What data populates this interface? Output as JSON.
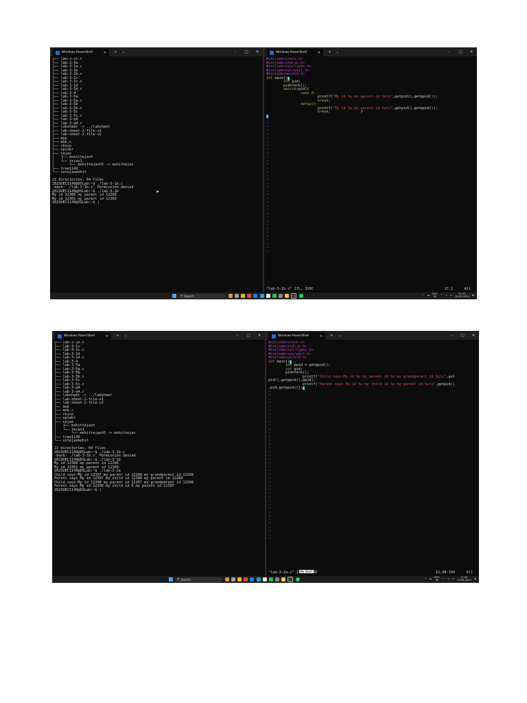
{
  "shots": [
    {
      "left": {
        "title": "Windows PowerShell",
        "lines": [
          "├── lab-3-2c.c",
          "├── lab-3-3a",
          "├── lab-3-1a.c",
          "├── lab-3-1b",
          "├── lab-3-1b.c",
          "├── lab-3-1c",
          "├── lab-3-1c.c",
          "├── lab-3-1d",
          "├── lab-3-1d.c",
          "├── lab-3-4",
          "├── lab-3-5a",
          "├── lab-3-5a.c",
          "├── lab-3-5b",
          "├── lab-3-5b.c",
          "├── lab-3-5c",
          "├── lab-3-5c.c",
          "├── lab-3-q4",
          "├── lab-3-q4.c",
          "├── labsheet -> ../labsheet",
          "├── lab-sheet-2-file-v1",
          "├── lab-sheet-2-file-v2",
          "├── mok",
          "├── mok.c",
          "├── rhino",
          "├── spider",
          "├── tejas",
          "│   ├── mohittejash",
          "│   └── tejas1",
          "│       └── mohittejash5 -> mohittejas",
          "├── tree1149",
          "└── ustejasmohit",
          "",
          "21 directories, 64 files",
          "2023UEC1149@OSLab:~$ ./lab-3-1b.c",
          "-bash: ./lab-3-1b.c: Permission denied",
          "2023UEC1149@OSLab:~$ ./lab-3-1b",
          "My id 12360 my parent id 12268",
          "My id 12361 my parent id 12360",
          "2023UEC1149@OSLab:~$ |"
        ]
      },
      "right": {
        "title": "Windows PowerShell",
        "code": [
          [
            [
              "cm",
              "#include<stdio.h>"
            ]
          ],
          [
            [
              "cm",
              "#include<stdlib.h>"
            ]
          ],
          [
            [
              "cm",
              "#include<sys/types.h>"
            ]
          ],
          [
            [
              "cm",
              "#include<sys/wait.h>"
            ]
          ],
          [
            [
              "cm",
              "#include<unistd.h>"
            ]
          ],
          [
            [
              "ky",
              "int"
            ],
            [
              "tx",
              " main()"
            ],
            [
              "cur",
              ""
            ]
          ],
          [
            [
              "tx",
              "        "
            ],
            [
              "ky",
              "int"
            ],
            [
              "tx",
              " pid;"
            ]
          ],
          [
            [
              "tx",
              "        pid=fork();"
            ]
          ],
          [
            [
              "tx",
              "        "
            ],
            [
              "ky",
              "switch"
            ],
            [
              "tx",
              "(pid){"
            ]
          ],
          [
            [
              "tx",
              "                "
            ],
            [
              "ky",
              "case 0:"
            ]
          ],
          [
            [
              "tx",
              "                        printf("
            ],
            [
              "st",
              "\"My id %u my parent id %u\\n\""
            ],
            [
              "tx",
              ",getpid(),getppid());"
            ]
          ],
          [
            [
              "tx",
              "                        "
            ],
            [
              "ky",
              "break;"
            ]
          ],
          [
            [
              "tx",
              "                "
            ],
            [
              "ky",
              "default:"
            ]
          ],
          [
            [
              "tx",
              "                        printf("
            ],
            [
              "st",
              "\"My id %u my parent id %u\\n\""
            ],
            [
              "tx",
              ",getpid(),getppid());"
            ]
          ],
          [
            [
              "tx",
              "                        "
            ],
            [
              "ky",
              "break;"
            ],
            [
              "tx",
              "              }"
            ]
          ],
          [
            [
              "cur",
              ""
            ]
          ]
        ],
        "status_file": "\"lab-3-1b.c\" 17L, 310C",
        "status_pos": "17,1",
        "status_all": "All"
      },
      "taskbar": {
        "search": "Search",
        "lang": "ENG\nIN",
        "time": "21:43\n19-09-2024"
      }
    },
    {
      "left": {
        "title": "Windows PowerShell",
        "lines": [
          "├── lab-3-1b.c",
          "├── lab-3-1c",
          "├── lab-3-1c.c",
          "├── lab-3-1d",
          "├── lab-3-1d.c",
          "├── lab-3-4",
          "├── lab-3-5a",
          "├── lab-3-5a.c",
          "├── lab-3-5b",
          "├── lab-3-5b.c",
          "├── lab-3-5c",
          "├── lab-3-5c.c",
          "├── lab-3-q4",
          "├── lab-3-q4.c",
          "├── labsheet -> ../labsheet",
          "├── lab-sheet-2-file-v1",
          "├── lab-sheet-2-file-v2",
          "├── mok",
          "├── mok.c",
          "├── rhino",
          "├── spider",
          "├── tejas",
          "│   ├── mohittejash",
          "│   └── tejas1",
          "│       └── mohittejash5 -> mohittejas",
          "├── tree1149",
          "└── ustejasmohit",
          "",
          "21 directories, 64 files",
          "2023UEC1149@OSLab:~$ ./lab-3-1b.c",
          "-bash: ./lab-3-1b.c: Permission denied",
          "2023UEC1149@OSLab:~$ ./lab-3-1b",
          "My id 12360 my parent id 12268",
          "My id 12361 my parent id 12360",
          "2023UEC1149@OSLab:~$ ./lab-3-2a",
          "Child says-My id 12397 my parent id 12268 my grandparent id 12268",
          "Parent says My id 12397 my child id 12398 my parent id 12268",
          "Child says-My id 12398 my parent id 12397 my grandparent id 12268",
          "Parent says My id 12398 my child id 0 my parent id 12397",
          "2023UEC1149@OSLab:~$ |"
        ]
      },
      "right": {
        "title": "Windows PowerShell",
        "code": [
          [
            [
              "cm",
              "#include<stdio.h>"
            ]
          ],
          [
            [
              "cm",
              "#include<stdlib.h>"
            ]
          ],
          [
            [
              "cm",
              "#include<sys/types.h>"
            ]
          ],
          [
            [
              "cm",
              "#include<sys/wait.h>"
            ]
          ],
          [
            [
              "cm",
              "#include<unistd.h>"
            ]
          ],
          [
            [
              "ky",
              "int"
            ],
            [
              "tx",
              " main()"
            ],
            [
              "cur",
              ""
            ]
          ],
          [
            [
              "tx",
              "        "
            ],
            [
              "ky",
              "int"
            ],
            [
              "tx",
              " ppid = getppid();"
            ]
          ],
          [
            [
              "tx",
              "        "
            ],
            [
              "ky",
              "int"
            ],
            [
              "tx",
              " pid;"
            ]
          ],
          [
            [
              "tx",
              "        pid=fork();"
            ]
          ],
          [
            [
              "tx",
              "                printf("
            ],
            [
              "st",
              "\"Child says-My id %u my parent id %u my grandparent id %u\\n\""
            ],
            [
              "tx",
              ",get"
            ]
          ],
          [
            [
              "tx",
              "pid(),getppid(),ppid);"
            ]
          ],
          [
            [
              "tx",
              "                printf("
            ],
            [
              "st",
              "\"Parent says My id %u my child id %u my parent id %u\\n\""
            ],
            [
              "tx",
              ",getpid()"
            ]
          ],
          [
            [
              "tx",
              ",pid,getppid());"
            ],
            [
              "cur",
              ""
            ]
          ]
        ],
        "status_file": "\"lab-3-2a.c\" 1",
        "status_tooltip": "My Shell",
        "status_rest": "0C",
        "status_pos": "12,90-104",
        "status_all": "All"
      },
      "taskbar": {
        "search": "Search",
        "lang": "ENG\nIN",
        "time": "21:45\n19-09-2024"
      }
    }
  ]
}
